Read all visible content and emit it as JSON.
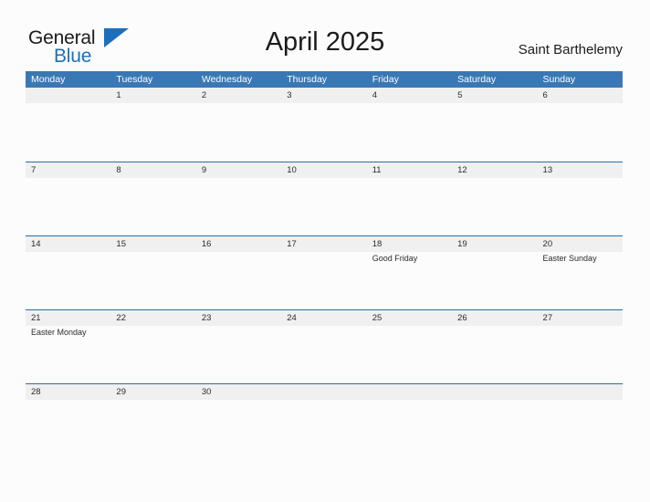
{
  "header": {
    "logo": {
      "word_one": "General",
      "word_two": "Blue",
      "triangle_icon": "triangle-icon"
    },
    "month_title": "April 2025",
    "location": "Saint Barthelemy"
  },
  "calendar": {
    "weekdays": [
      "Monday",
      "Tuesday",
      "Wednesday",
      "Thursday",
      "Friday",
      "Saturday",
      "Sunday"
    ],
    "colors": {
      "header_blue": "#3a78b5",
      "divider_blue": "#2c6ca4",
      "day_band_gray": "#f0f0f0",
      "logo_blue": "#1e6fbb",
      "page_background": "#fcfcfc",
      "text": "#2b2b2b"
    },
    "weeks": [
      [
        {
          "date": "",
          "events": []
        },
        {
          "date": "1",
          "events": []
        },
        {
          "date": "2",
          "events": []
        },
        {
          "date": "3",
          "events": []
        },
        {
          "date": "4",
          "events": []
        },
        {
          "date": "5",
          "events": []
        },
        {
          "date": "6",
          "events": []
        }
      ],
      [
        {
          "date": "7",
          "events": []
        },
        {
          "date": "8",
          "events": []
        },
        {
          "date": "9",
          "events": []
        },
        {
          "date": "10",
          "events": []
        },
        {
          "date": "11",
          "events": []
        },
        {
          "date": "12",
          "events": []
        },
        {
          "date": "13",
          "events": []
        }
      ],
      [
        {
          "date": "14",
          "events": []
        },
        {
          "date": "15",
          "events": []
        },
        {
          "date": "16",
          "events": []
        },
        {
          "date": "17",
          "events": []
        },
        {
          "date": "18",
          "events": [
            "Good Friday"
          ]
        },
        {
          "date": "19",
          "events": []
        },
        {
          "date": "20",
          "events": [
            "Easter Sunday"
          ]
        }
      ],
      [
        {
          "date": "21",
          "events": [
            "Easter Monday"
          ]
        },
        {
          "date": "22",
          "events": []
        },
        {
          "date": "23",
          "events": []
        },
        {
          "date": "24",
          "events": []
        },
        {
          "date": "25",
          "events": []
        },
        {
          "date": "26",
          "events": []
        },
        {
          "date": "27",
          "events": []
        }
      ],
      [
        {
          "date": "28",
          "events": []
        },
        {
          "date": "29",
          "events": []
        },
        {
          "date": "30",
          "events": []
        },
        {
          "date": "",
          "events": []
        },
        {
          "date": "",
          "events": []
        },
        {
          "date": "",
          "events": []
        },
        {
          "date": "",
          "events": []
        }
      ]
    ]
  }
}
